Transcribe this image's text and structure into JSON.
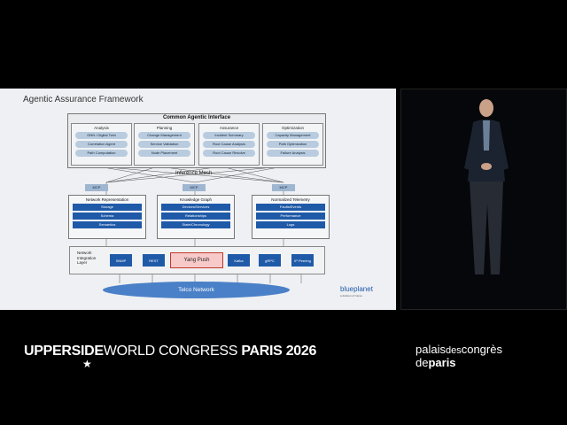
{
  "slide": {
    "title": "Agentic Assurance Framework",
    "interface_title": "Common Agentic Interface",
    "columns": [
      {
        "title": "Analysis",
        "items": [
          "GNN / Digital Twin",
          "Correlation Agent",
          "Path Computation"
        ]
      },
      {
        "title": "Planning",
        "items": [
          "Change Management",
          "Service Validation",
          "Node Placement"
        ]
      },
      {
        "title": "Assurance",
        "items": [
          "Incident Summary",
          "Root Cause Analysis",
          "Root Cause Resolve"
        ]
      },
      {
        "title": "Optimization",
        "items": [
          "Capacity Management",
          "Path Optimization",
          "Failure Analysis"
        ]
      }
    ],
    "mesh_label": "Inference Mesh",
    "mcp_label": "MCP",
    "knowledge": [
      {
        "title": "Network Representation",
        "items": [
          "Storage",
          "Schema",
          "Semantics"
        ]
      },
      {
        "title": "Knowledge Graph",
        "items": [
          "Devices/Services",
          "Relationships",
          "State/Chronology"
        ]
      },
      {
        "title": "Normalized Telemetry",
        "items": [
          "Faults/Events",
          "Performance",
          "Logs"
        ]
      }
    ],
    "integration_label": "Network Integration Layer",
    "protocols": [
      "SNMP",
      "REST",
      "Kafka",
      "gRPC",
      "IP Peering"
    ],
    "yang_push": "Yang Push",
    "telco": "Telco Network",
    "brand": "blueplanet",
    "brand_sub": "a division of Ciena"
  },
  "footer": {
    "upperside": "UPPERSIDE",
    "world_congress": "WORLD CONGRESS",
    "paris": "PARIS",
    "year": "2026",
    "palais": "palais",
    "des": "des",
    "congres": "congrès",
    "de": "de",
    "paris_venue": "paris"
  }
}
